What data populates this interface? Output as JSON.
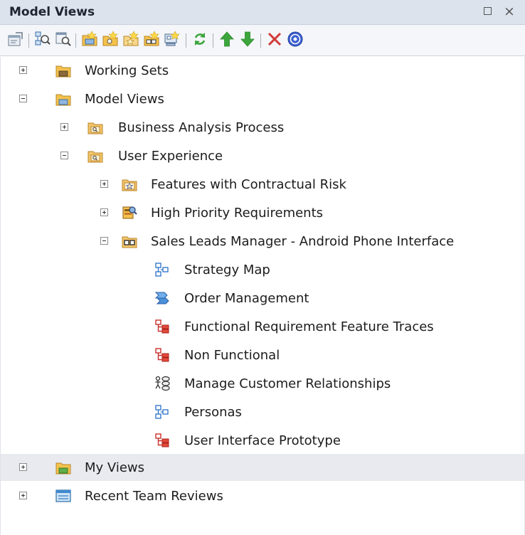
{
  "window": {
    "title": "Model Views",
    "restore_icon": "restore-icon",
    "close_label": "×"
  },
  "toolbar": {
    "buttons": [
      {
        "icon": "properties-icon"
      },
      {
        "icon": "find-in-diagram-icon"
      },
      {
        "icon": "find-in-browser-icon"
      },
      {
        "icon": "new-view-folder-icon"
      },
      {
        "icon": "new-search-view-icon"
      },
      {
        "icon": "new-favorites-icon"
      },
      {
        "icon": "new-slideshow-icon"
      },
      {
        "icon": "new-diagram-link-icon"
      },
      {
        "icon": "refresh-icon"
      },
      {
        "icon": "move-up-icon"
      },
      {
        "icon": "move-down-icon"
      },
      {
        "icon": "delete-icon"
      },
      {
        "icon": "help-icon"
      }
    ]
  },
  "tree": {
    "items": [
      {
        "label": "Working Sets",
        "icon": "working-sets-folder-icon",
        "expander": "plus"
      },
      {
        "label": "Model Views",
        "icon": "model-views-folder-icon",
        "expander": "minus"
      },
      {
        "label": "Business Analysis Process",
        "icon": "search-folder-icon",
        "expander": "plus"
      },
      {
        "label": "User Experience",
        "icon": "search-folder-icon",
        "expander": "minus"
      },
      {
        "label": "Features with Contractual Risk",
        "icon": "favorites-folder-icon",
        "expander": "plus"
      },
      {
        "label": "High Priority Requirements",
        "icon": "search-view-icon",
        "expander": "plus"
      },
      {
        "label": "Sales Leads Manager - Android Phone Interface",
        "icon": "slideshow-folder-icon",
        "expander": "minus"
      },
      {
        "label": "Strategy Map",
        "icon": "strategy-diagram-icon"
      },
      {
        "label": "Order Management",
        "icon": "process-diagram-icon"
      },
      {
        "label": "Functional Requirement Feature Traces",
        "icon": "requirements-diagram-icon"
      },
      {
        "label": "Non Functional",
        "icon": "requirements-diagram-icon"
      },
      {
        "label": "Manage Customer Relationships",
        "icon": "use-case-diagram-icon"
      },
      {
        "label": "Personas",
        "icon": "strategy-diagram-icon"
      },
      {
        "label": "User Interface Prototype",
        "icon": "requirements-diagram-icon"
      },
      {
        "label": "My Views",
        "icon": "my-views-folder-icon",
        "expander": "plus"
      },
      {
        "label": "Recent Team Reviews",
        "icon": "team-reviews-icon",
        "expander": "plus"
      }
    ]
  },
  "colors": {
    "title_bg": "#dde3ec",
    "toolbar_bg": "#f4f6f9",
    "highlight_row": "#e8eaef",
    "folder_yellow": "#f4c24c",
    "diagram_red": "#c9302c",
    "diagram_blue": "#2a6fc9",
    "arrow_green": "#3ca53c",
    "delete_red": "#d23a3a"
  }
}
